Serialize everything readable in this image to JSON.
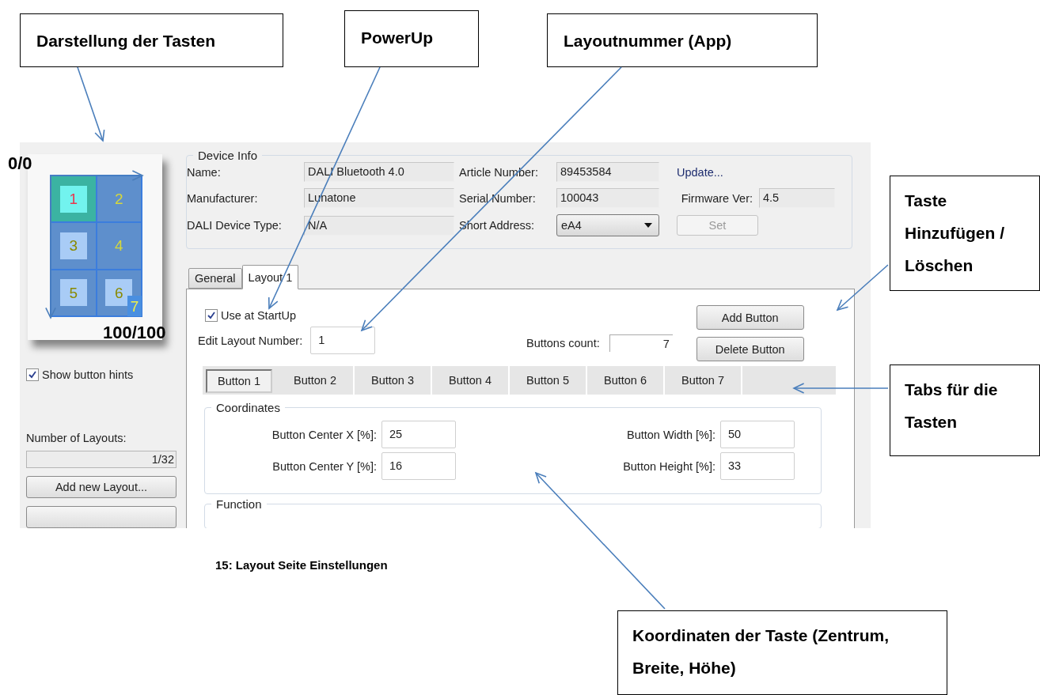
{
  "callouts": [
    {
      "text": "Darstellung der Tasten"
    },
    {
      "text": "PowerUp"
    },
    {
      "text": "Layoutnummer (App)"
    },
    {
      "text": "Taste Hinzufügen / Löschen"
    },
    {
      "text": "Tabs für die Tasten"
    },
    {
      "text": "Koordinaten der Taste (Zentrum, Breite, Höhe)"
    }
  ],
  "corner_labels": [
    "0/0",
    "100/100"
  ],
  "caption": "15: Layout Seite Einstellungen",
  "preview": {
    "buttons": [
      {
        "label": "1",
        "selected": true,
        "filled": true,
        "color": "#e8384f"
      },
      {
        "label": "2",
        "selected": false,
        "filled": false,
        "color": "#d6d83a"
      },
      {
        "label": "3",
        "selected": false,
        "filled": true,
        "color": "#8a8a00"
      },
      {
        "label": "4",
        "selected": false,
        "filled": false,
        "color": "#d6d83a"
      },
      {
        "label": "5",
        "selected": false,
        "filled": true,
        "color": "#8a8a00"
      },
      {
        "label": "6",
        "selected": false,
        "filled": true,
        "color": "#8a8a00"
      },
      {
        "label": "7",
        "selected": false,
        "filled": true,
        "color": "#f0f048"
      }
    ]
  },
  "show_button_hints": {
    "label": "Show button hints",
    "checked": true
  },
  "layouts": {
    "label": "Number of Layouts:",
    "count": "1/32",
    "button": "Add new Layout..."
  },
  "device_info": {
    "title": "Device Info",
    "rows": [
      [
        {
          "kind": "field",
          "label": "Name:",
          "value": "DALI Bluetooth 4.0"
        },
        {
          "kind": "field",
          "label": "Article Number:",
          "value": "89453584"
        },
        {
          "kind": "link",
          "label": "Update..."
        }
      ],
      [
        {
          "kind": "field",
          "label": "Manufacturer:",
          "value": "Lunatone"
        },
        {
          "kind": "field",
          "label": "Serial Number:",
          "value": "100043"
        },
        {
          "kind": "field",
          "label": "Firmware Ver:",
          "value": "4.5"
        }
      ],
      [
        {
          "kind": "field",
          "label": "DALI Device Type:",
          "value": "N/A"
        },
        {
          "kind": "select",
          "label": "Short Address:",
          "value": "eA4"
        },
        {
          "kind": "button",
          "label": "Set",
          "disabled": true
        }
      ]
    ]
  },
  "tabs": [
    {
      "label": "General",
      "selected": false
    },
    {
      "label": "Layout 1",
      "selected": true
    }
  ],
  "layout": {
    "use_at_startup": {
      "label": "Use at StartUp",
      "checked": true
    },
    "edit_layout_number": {
      "label": "Edit Layout Number:",
      "value": "1"
    },
    "buttons_count": {
      "label": "Buttons count:",
      "value": "7"
    },
    "actions": [
      "Add Button",
      "Delete Button"
    ],
    "button_tabs": [
      {
        "label": "Button 1",
        "selected": true
      },
      {
        "label": "Button 2",
        "selected": false
      },
      {
        "label": "Button 3",
        "selected": false
      },
      {
        "label": "Button 4",
        "selected": false
      },
      {
        "label": "Button 5",
        "selected": false
      },
      {
        "label": "Button 6",
        "selected": false
      },
      {
        "label": "Button 7",
        "selected": false
      }
    ],
    "coordinates": {
      "title": "Coordinates",
      "fields": [
        {
          "label": "Button Center X [%]:",
          "value": "25"
        },
        {
          "label": "Button Width [%]:",
          "value": "50"
        },
        {
          "label": "Button Center Y [%]:",
          "value": "16"
        },
        {
          "label": "Button Height [%]:",
          "value": "33"
        }
      ]
    },
    "function": {
      "title": "Function"
    }
  }
}
